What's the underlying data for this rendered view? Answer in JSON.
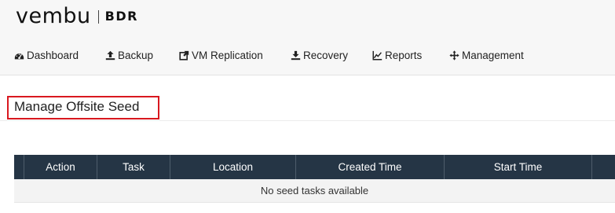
{
  "brand": {
    "name": "vembu",
    "product": "BDR"
  },
  "nav": {
    "dashboard": {
      "label": "Dashboard",
      "icon": "dashboard-icon"
    },
    "backup": {
      "label": "Backup",
      "icon": "upload-icon"
    },
    "vm_replication": {
      "label": "VM Replication",
      "icon": "replicate-icon"
    },
    "recovery": {
      "label": "Recovery",
      "icon": "download-icon"
    },
    "reports": {
      "label": "Reports",
      "icon": "line-chart-icon"
    },
    "management": {
      "label": "Management",
      "icon": "arrows-icon"
    }
  },
  "page": {
    "title": "Manage Offsite Seed"
  },
  "table": {
    "columns": [
      "Action",
      "Task",
      "Location",
      "Created Time",
      "Start Time"
    ],
    "empty_message": "No seed tasks available"
  },
  "colors": {
    "header_bg": "#f7f7f7",
    "table_header_bg": "#253545",
    "highlight_border": "#d9181f"
  }
}
